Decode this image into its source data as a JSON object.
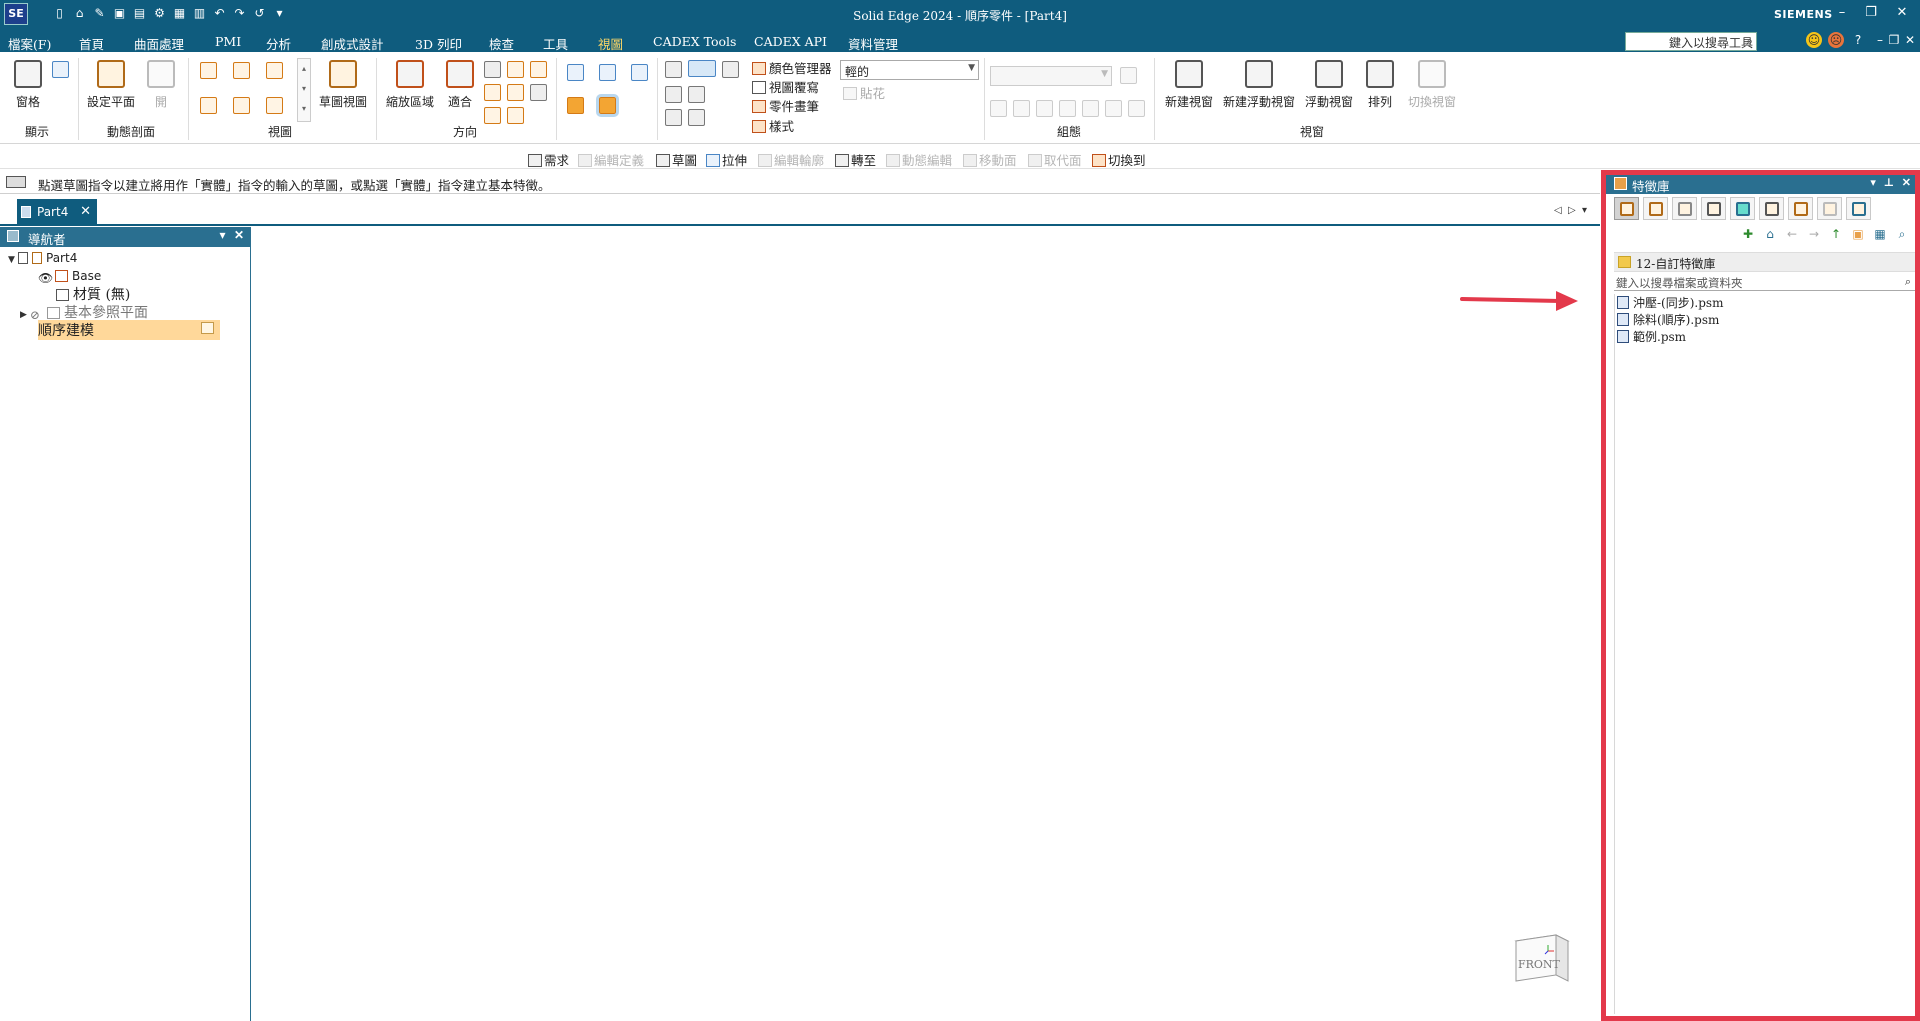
{
  "app": {
    "logo": "SE",
    "title": "Solid Edge 2024 - 順序零件 - [Part4]",
    "brand": "SIEMENS"
  },
  "menu": {
    "tabs": [
      "檔案(F)",
      "首頁",
      "曲面處理",
      "PMI",
      "分析",
      "創成式設計",
      "3D 列印",
      "檢查",
      "工具",
      "視圖",
      "CADEX Tools",
      "CADEX API",
      "資料管理"
    ],
    "active_tab": "視圖",
    "search_placeholder": "鍵入以搜尋工具"
  },
  "ribbon": {
    "show": {
      "window_label": "窗格",
      "group_label": "顯示"
    },
    "section": {
      "set_plane_label": "設定平面",
      "open_label": "開",
      "group_label": "動態剖面"
    },
    "views": {
      "sketch_view_label": "草圖視圖",
      "group_label": "視圖"
    },
    "orient": {
      "zoom_area_label": "縮放區域",
      "fit_label": "適合",
      "group_label": "方向"
    },
    "style": {
      "color_manager_label": "顏色管理器",
      "view_overlay_label": "視圖覆寫",
      "part_painter_label": "零件畫筆",
      "styles_label": "樣式",
      "decal_label": "貼花",
      "style_combo_value": "輕的"
    },
    "group3": {
      "group_label": "組態"
    },
    "window": {
      "new_window_label": "新建視窗",
      "new_floating_window_label": "新建浮動視窗",
      "floating_window_label": "浮動視窗",
      "arrange_label": "排列",
      "switch_window_label": "切換視窗",
      "group_label": "視窗"
    }
  },
  "command_bar": {
    "items": [
      {
        "label": "需求",
        "enabled": true
      },
      {
        "label": "編輯定義",
        "enabled": false
      },
      {
        "label": "草圖",
        "enabled": true
      },
      {
        "label": "拉伸",
        "enabled": true
      },
      {
        "label": "編輯輪廓",
        "enabled": false
      },
      {
        "label": "轉至",
        "enabled": true
      },
      {
        "label": "動態編輯",
        "enabled": false
      },
      {
        "label": "移動面",
        "enabled": false
      },
      {
        "label": "取代面",
        "enabled": false
      },
      {
        "label": "切換到",
        "enabled": true
      }
    ]
  },
  "prompt": {
    "text": "點選草圖指令以建立將用作「實體」指令的輸入的草圖，或點選「實體」指令建立基本特徵。"
  },
  "document_tab": {
    "label": "Part4"
  },
  "navigator": {
    "title": "導航者",
    "tree": {
      "root": "Part4",
      "base": "Base",
      "material": "材質 (無)",
      "ref_planes": "基本參照平面",
      "ordered": "順序建模"
    }
  },
  "view_cube": {
    "label": "FRONT"
  },
  "feature_library": {
    "title": "特徵庫",
    "folder": "12-自訂特徵庫",
    "search_placeholder": "鍵入以搜尋檔案或資料夾",
    "files": [
      "沖壓-(同步).psm",
      "除料(順序).psm",
      "範例.psm"
    ]
  },
  "colors": {
    "title_bar": "#0f5c7e",
    "panel_header": "#2a6f90",
    "highlight_border": "#e3394b",
    "active_tab": "#ffd966",
    "arrow": "#e3394b"
  }
}
